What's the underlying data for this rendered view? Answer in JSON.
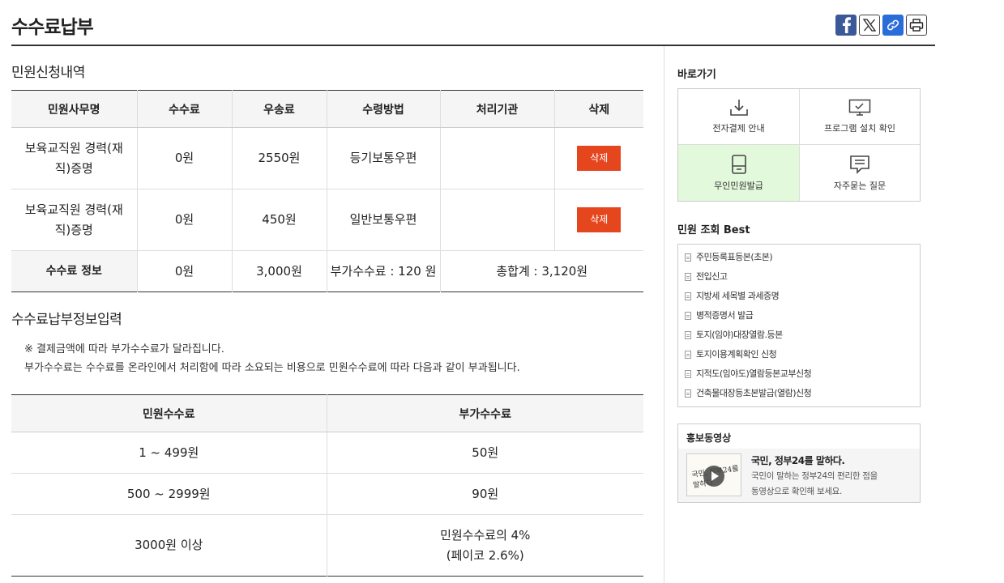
{
  "page_title": "수수료납부",
  "share": [
    {
      "name": "facebook-share-icon"
    },
    {
      "name": "x-share-icon"
    },
    {
      "name": "link-copy-icon"
    },
    {
      "name": "print-icon"
    }
  ],
  "request": {
    "section_title": "민원신청내역",
    "headers": [
      "민원사무명",
      "수수료",
      "우송료",
      "수령방법",
      "처리기관",
      "삭제"
    ],
    "rows": [
      {
        "name": "보육교직원 경력(재직)증명",
        "fee": "0원",
        "postage": "2550원",
        "method": "등기보통우편",
        "agency": "",
        "delete": "삭제"
      },
      {
        "name": "보육교직원 경력(재직)증명",
        "fee": "0원",
        "postage": "450원",
        "method": "일반보통우편",
        "agency": "",
        "delete": "삭제"
      }
    ],
    "summary": {
      "label": "수수료 정보",
      "fee": "0원",
      "postage": "3,000원",
      "extra": "부가수수료 : 120 원",
      "total": "총합계 : 3,120원"
    }
  },
  "payment": {
    "section_title": "수수료납부정보입력",
    "notice_1": "※ 결제금액에 따라 부가수수료가 달라집니다.",
    "notice_2": "부가수수료는 수수료를 온라인에서 처리함에 따라 소요되는 비용으로 민원수수료에 따라 다음과 같이 부과됩니다.",
    "headers": [
      "민원수수료",
      "부가수수료"
    ],
    "rows": [
      {
        "range": "1 ~ 499원",
        "extra": "50원",
        "extra_2": ""
      },
      {
        "range": "500 ~ 2999원",
        "extra": "90원",
        "extra_2": ""
      },
      {
        "range": "3000원 이상",
        "extra": "민원수수료의 4%",
        "extra_2": "(페이코 2.6%)"
      }
    ]
  },
  "sidebar": {
    "shortcut_title": "바로가기",
    "shortcuts": [
      {
        "label": "전자결제 안내",
        "icon": "download-icon"
      },
      {
        "label": "프로그램 설치 확인",
        "icon": "monitor-check-icon"
      },
      {
        "label": "무인민원발급",
        "icon": "kiosk-icon"
      },
      {
        "label": "자주묻는 질문",
        "icon": "chat-bubble-icon"
      }
    ],
    "best_title": "민원 조회 Best",
    "best_items": [
      "주민등록표등본(초본)",
      "전입신고",
      "지방세 세목별 과세증명",
      "병적증명서 발급",
      "토지(임야)대장열람.등본",
      "토지이용계획확인 신청",
      "지적도(임야도)열람등본교부신청",
      "건축물대장등초본발급(열람)신청"
    ],
    "video": {
      "title": "홍보동영상",
      "headline": "국민, 정부24를 말하다.",
      "desc_1": "국민이 말하는 정부24의 편리한 점을",
      "desc_2": "동영상으로 확인해 보세요.",
      "thumb_text": "국민, 정부24를 말하다"
    }
  }
}
